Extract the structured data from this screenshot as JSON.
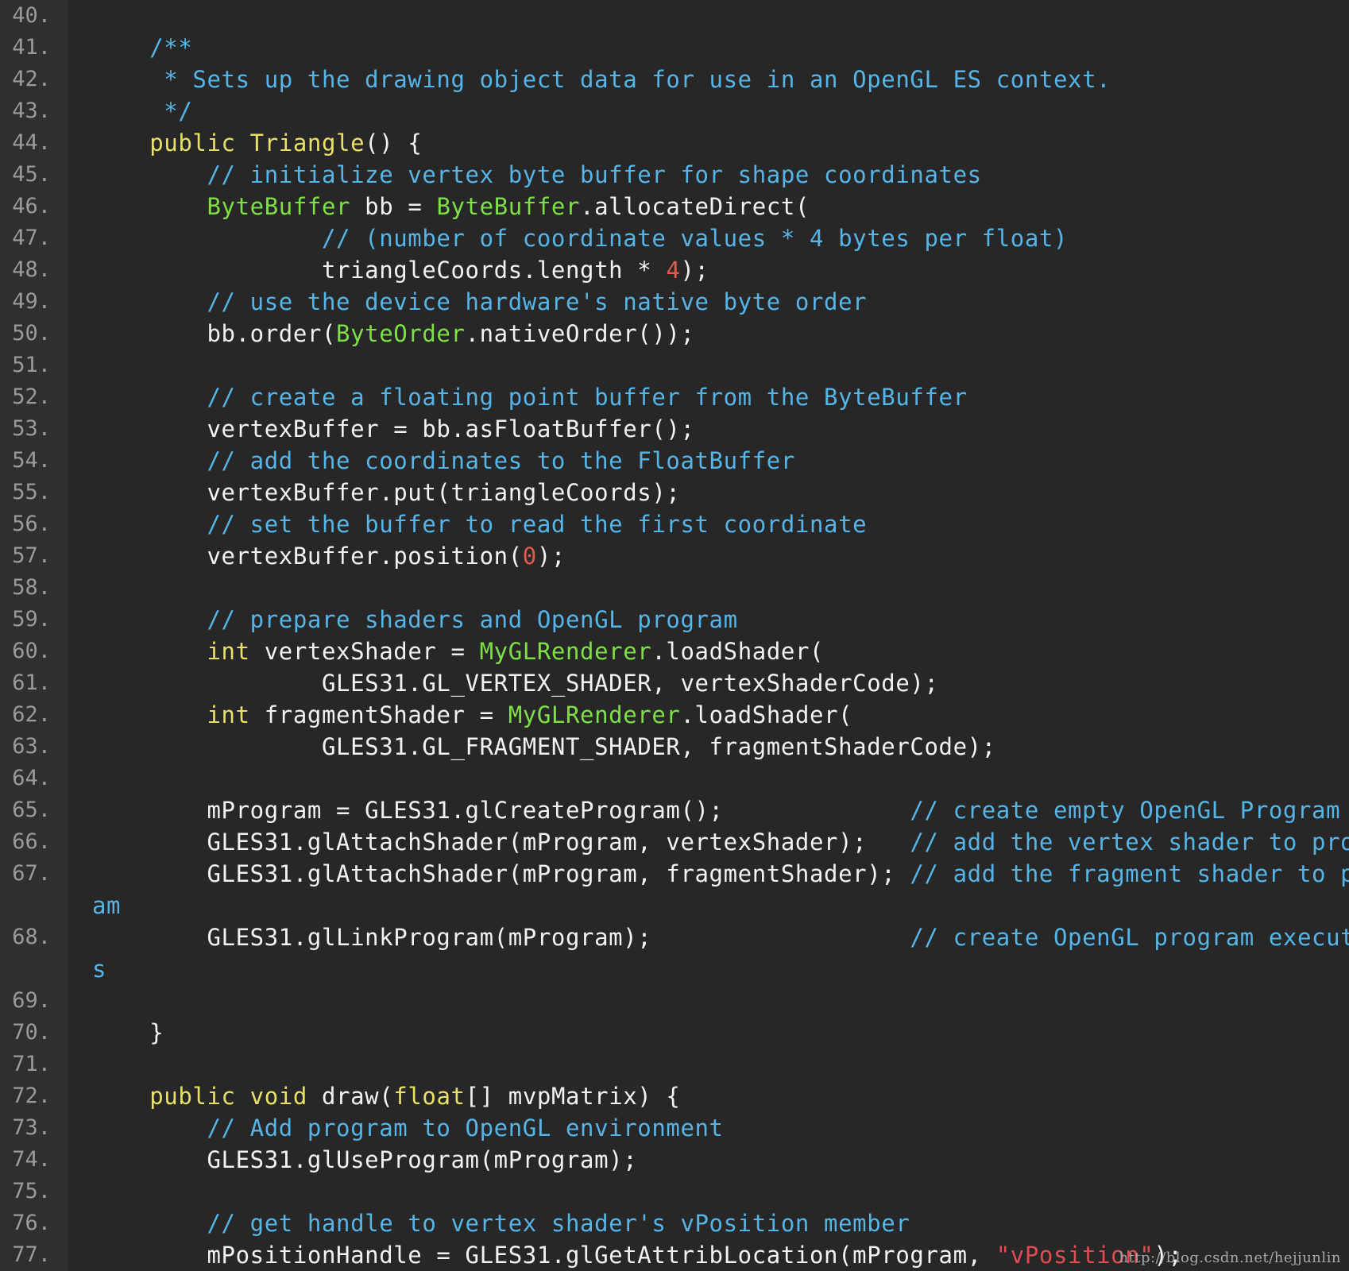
{
  "colors": {
    "background": "#272727",
    "gutter": "#2f2f2f",
    "line_number": "#9a9a9a",
    "comment": "#55b5e8",
    "keyword": "#e8e067",
    "type": "#7ee047",
    "number": "#e15a4e",
    "string": "#e24b52",
    "text": "#f2f2f2"
  },
  "lines": [
    {
      "n": "40.",
      "tokens": []
    },
    {
      "n": "41.",
      "tokens": [
        {
          "t": "    /**",
          "c": "cm"
        }
      ]
    },
    {
      "n": "42.",
      "tokens": [
        {
          "t": "     * Sets up the drawing object data for use in an OpenGL ES context.",
          "c": "cm"
        }
      ]
    },
    {
      "n": "43.",
      "tokens": [
        {
          "t": "     */",
          "c": "cm"
        }
      ]
    },
    {
      "n": "44.",
      "tokens": [
        {
          "t": "    ",
          "c": "tx"
        },
        {
          "t": "public",
          "c": "kw"
        },
        {
          "t": " ",
          "c": "tx"
        },
        {
          "t": "Triangle",
          "c": "kw"
        },
        {
          "t": "() {",
          "c": "tx"
        }
      ]
    },
    {
      "n": "45.",
      "tokens": [
        {
          "t": "        // initialize vertex byte buffer for shape coordinates",
          "c": "cm"
        }
      ]
    },
    {
      "n": "46.",
      "tokens": [
        {
          "t": "        ",
          "c": "tx"
        },
        {
          "t": "ByteBuffer",
          "c": "ty"
        },
        {
          "t": " bb = ",
          "c": "tx"
        },
        {
          "t": "ByteBuffer",
          "c": "ty"
        },
        {
          "t": ".allocateDirect(",
          "c": "tx"
        }
      ]
    },
    {
      "n": "47.",
      "tokens": [
        {
          "t": "                // (number of coordinate values * 4 bytes per float)",
          "c": "cm"
        }
      ]
    },
    {
      "n": "48.",
      "tokens": [
        {
          "t": "                triangleCoords.length * ",
          "c": "tx"
        },
        {
          "t": "4",
          "c": "nm"
        },
        {
          "t": ");",
          "c": "tx"
        }
      ]
    },
    {
      "n": "49.",
      "tokens": [
        {
          "t": "        // use the device hardware's native byte order",
          "c": "cm"
        }
      ]
    },
    {
      "n": "50.",
      "tokens": [
        {
          "t": "        bb.order(",
          "c": "tx"
        },
        {
          "t": "ByteOrder",
          "c": "ty"
        },
        {
          "t": ".nativeOrder());",
          "c": "tx"
        }
      ]
    },
    {
      "n": "51.",
      "tokens": []
    },
    {
      "n": "52.",
      "tokens": [
        {
          "t": "        // create a floating point buffer from the ByteBuffer",
          "c": "cm"
        }
      ]
    },
    {
      "n": "53.",
      "tokens": [
        {
          "t": "        vertexBuffer = bb.asFloatBuffer();",
          "c": "tx"
        }
      ]
    },
    {
      "n": "54.",
      "tokens": [
        {
          "t": "        // add the coordinates to the FloatBuffer",
          "c": "cm"
        }
      ]
    },
    {
      "n": "55.",
      "tokens": [
        {
          "t": "        vertexBuffer.put(triangleCoords);",
          "c": "tx"
        }
      ]
    },
    {
      "n": "56.",
      "tokens": [
        {
          "t": "        // set the buffer to read the first coordinate",
          "c": "cm"
        }
      ]
    },
    {
      "n": "57.",
      "tokens": [
        {
          "t": "        vertexBuffer.position(",
          "c": "tx"
        },
        {
          "t": "0",
          "c": "nm"
        },
        {
          "t": ");",
          "c": "tx"
        }
      ]
    },
    {
      "n": "58.",
      "tokens": []
    },
    {
      "n": "59.",
      "tokens": [
        {
          "t": "        // prepare shaders and OpenGL program",
          "c": "cm"
        }
      ]
    },
    {
      "n": "60.",
      "tokens": [
        {
          "t": "        ",
          "c": "tx"
        },
        {
          "t": "int",
          "c": "kw"
        },
        {
          "t": " vertexShader = ",
          "c": "tx"
        },
        {
          "t": "MyGLRenderer",
          "c": "ty"
        },
        {
          "t": ".loadShader(",
          "c": "tx"
        }
      ]
    },
    {
      "n": "61.",
      "tokens": [
        {
          "t": "                GLES31.GL_VERTEX_SHADER, vertexShaderCode);",
          "c": "tx"
        }
      ]
    },
    {
      "n": "62.",
      "tokens": [
        {
          "t": "        ",
          "c": "tx"
        },
        {
          "t": "int",
          "c": "kw"
        },
        {
          "t": " fragmentShader = ",
          "c": "tx"
        },
        {
          "t": "MyGLRenderer",
          "c": "ty"
        },
        {
          "t": ".loadShader(",
          "c": "tx"
        }
      ]
    },
    {
      "n": "63.",
      "tokens": [
        {
          "t": "                GLES31.GL_FRAGMENT_SHADER, fragmentShaderCode);",
          "c": "tx"
        }
      ]
    },
    {
      "n": "64.",
      "tokens": []
    },
    {
      "n": "65.",
      "tokens": [
        {
          "t": "        mProgram = GLES31.glCreateProgram();             ",
          "c": "tx"
        },
        {
          "t": "// create empty OpenGL Program",
          "c": "cm"
        }
      ]
    },
    {
      "n": "66.",
      "tokens": [
        {
          "t": "        GLES31.glAttachShader(mProgram, vertexShader);   ",
          "c": "tx"
        },
        {
          "t": "// add the vertex shader to program",
          "c": "cm"
        }
      ]
    },
    {
      "n": "67.",
      "tokens": [
        {
          "t": "        GLES31.glAttachShader(mProgram, fragmentShader); ",
          "c": "tx"
        },
        {
          "t": "// add the fragment shader to progr",
          "c": "cm"
        }
      ]
    },
    {
      "n": "",
      "tokens": [
        {
          "t": "am",
          "c": "cm"
        }
      ],
      "wrap": true
    },
    {
      "n": "68.",
      "tokens": [
        {
          "t": "        GLES31.glLinkProgram(mProgram);                  ",
          "c": "tx"
        },
        {
          "t": "// create OpenGL program executable",
          "c": "cm"
        }
      ]
    },
    {
      "n": "",
      "tokens": [
        {
          "t": "s",
          "c": "cm"
        }
      ],
      "wrap": true
    },
    {
      "n": "69.",
      "tokens": []
    },
    {
      "n": "70.",
      "tokens": [
        {
          "t": "    }",
          "c": "tx"
        }
      ]
    },
    {
      "n": "71.",
      "tokens": []
    },
    {
      "n": "72.",
      "tokens": [
        {
          "t": "    ",
          "c": "tx"
        },
        {
          "t": "public",
          "c": "kw"
        },
        {
          "t": " ",
          "c": "tx"
        },
        {
          "t": "void",
          "c": "kw"
        },
        {
          "t": " draw(",
          "c": "tx"
        },
        {
          "t": "float",
          "c": "kw"
        },
        {
          "t": "[] mvpMatrix) {",
          "c": "tx"
        }
      ]
    },
    {
      "n": "73.",
      "tokens": [
        {
          "t": "        // Add program to OpenGL environment",
          "c": "cm"
        }
      ]
    },
    {
      "n": "74.",
      "tokens": [
        {
          "t": "        GLES31.glUseProgram(mProgram);",
          "c": "tx"
        }
      ]
    },
    {
      "n": "75.",
      "tokens": []
    },
    {
      "n": "76.",
      "tokens": [
        {
          "t": "        // get handle to vertex shader's vPosition member",
          "c": "cm"
        }
      ]
    },
    {
      "n": "77.",
      "tokens": [
        {
          "t": "        mPositionHandle = GLES31.glGetAttribLocation(mProgram, ",
          "c": "tx"
        },
        {
          "t": "\"vPosition\"",
          "c": "st"
        },
        {
          "t": ");",
          "c": "tx"
        }
      ]
    }
  ],
  "watermark": "http://blog.csdn.net/hejjunlin"
}
